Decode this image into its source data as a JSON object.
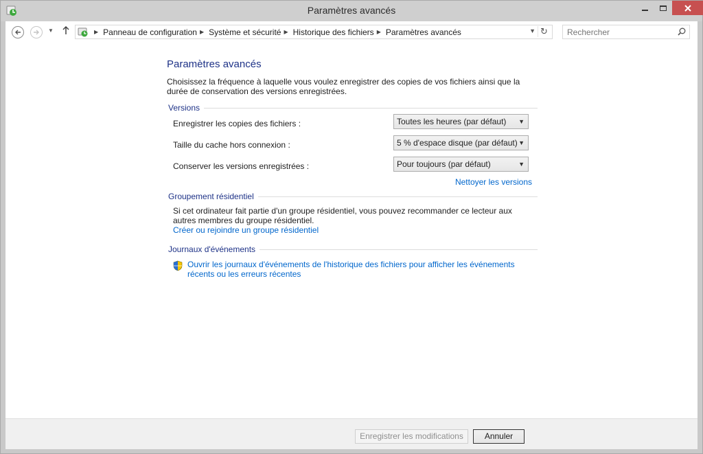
{
  "window": {
    "title": "Paramètres avancés"
  },
  "nav": {
    "breadcrumbs": [
      "Panneau de configuration",
      "Système et sécurité",
      "Historique des fichiers",
      "Paramètres avancés"
    ],
    "search_placeholder": "Rechercher"
  },
  "page": {
    "title": "Paramètres avancés",
    "description": "Choisissez la fréquence à laquelle vous voulez enregistrer des copies de vos fichiers ainsi que la durée de conservation des versions enregistrées."
  },
  "versions": {
    "header": "Versions",
    "rows": [
      {
        "label": "Enregistrer les copies des fichiers :",
        "value": "Toutes les heures (par défaut)"
      },
      {
        "label": "Taille du cache hors connexion :",
        "value": "5 % d'espace disque (par défaut)"
      },
      {
        "label": "Conserver les versions enregistrées :",
        "value": "Pour toujours (par défaut)"
      }
    ],
    "cleanup_link": "Nettoyer les versions"
  },
  "homegroup": {
    "header": "Groupement résidentiel",
    "text": "Si cet ordinateur fait partie d'un groupe résidentiel, vous pouvez recommander ce lecteur aux autres membres du groupe résidentiel.",
    "link": "Créer ou rejoindre un groupe résidentiel"
  },
  "events": {
    "header": "Journaux d'événements",
    "link": "Ouvrir les journaux d'événements de l'historique des fichiers pour afficher les événements récents ou les erreurs récentes"
  },
  "footer": {
    "save_label": "Enregistrer les modifications",
    "cancel_label": "Annuler"
  },
  "colors": {
    "accent_blue": "#1e3287",
    "link_blue": "#0066cc",
    "close_red": "#c75050"
  }
}
